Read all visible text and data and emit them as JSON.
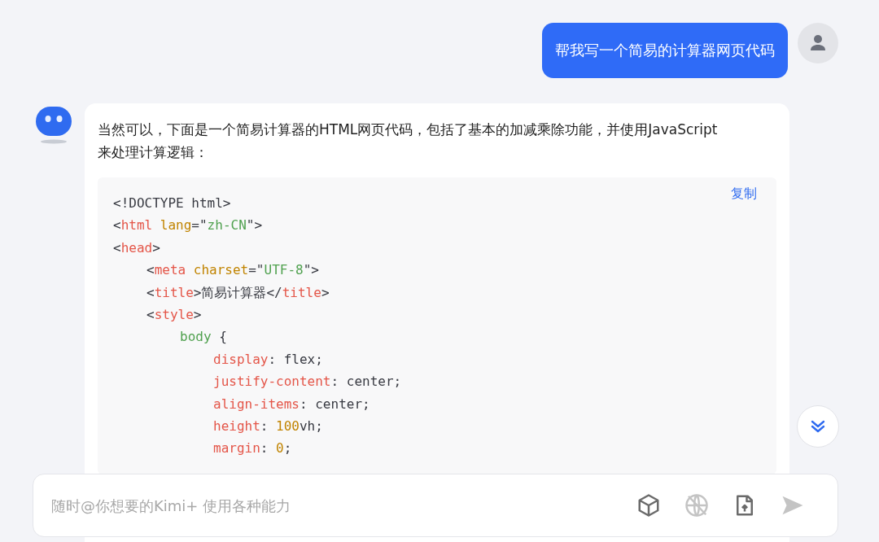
{
  "user_message": {
    "text": "帮我写一个简易的计算器网页代码"
  },
  "assistant_message": {
    "text": "当然可以，下面是一个简易计算器的HTML网页代码，包括了基本的加减乘除功能，并使用JavaScript来处理计算逻辑：",
    "code_block": {
      "copy_label": "复制",
      "lines": [
        {
          "tokens": [
            {
              "kind": "plain",
              "text": "<!DOCTYPE html>"
            }
          ]
        },
        {
          "tokens": [
            {
              "kind": "plain",
              "text": "<"
            },
            {
              "kind": "tag",
              "text": "html"
            },
            {
              "kind": "attr",
              "text": " lang"
            },
            {
              "kind": "plain",
              "text": "=\""
            },
            {
              "kind": "string",
              "text": "zh-CN"
            },
            {
              "kind": "plain",
              "text": "\">"
            }
          ]
        },
        {
          "tokens": [
            {
              "kind": "plain",
              "text": "<"
            },
            {
              "kind": "tag",
              "text": "head"
            },
            {
              "kind": "plain",
              "text": ">"
            }
          ],
          "children": [
            {
              "tokens": [
                {
                  "kind": "plain",
                  "text": "<"
                },
                {
                  "kind": "tag",
                  "text": "meta"
                },
                {
                  "kind": "attr",
                  "text": " charset"
                },
                {
                  "kind": "plain",
                  "text": "=\""
                },
                {
                  "kind": "string",
                  "text": "UTF-8"
                },
                {
                  "kind": "plain",
                  "text": "\">"
                }
              ]
            },
            {
              "tokens": [
                {
                  "kind": "plain",
                  "text": "<"
                },
                {
                  "kind": "tag",
                  "text": "title"
                },
                {
                  "kind": "plain",
                  "text": ">简易计算器</"
                },
                {
                  "kind": "tag",
                  "text": "title"
                },
                {
                  "kind": "plain",
                  "text": ">"
                }
              ]
            },
            {
              "tokens": [
                {
                  "kind": "plain",
                  "text": "<"
                },
                {
                  "kind": "tag",
                  "text": "style"
                },
                {
                  "kind": "plain",
                  "text": ">"
                }
              ],
              "children": [
                {
                  "tokens": [
                    {
                      "kind": "selector",
                      "text": "body"
                    },
                    {
                      "kind": "plain",
                      "text": " {"
                    }
                  ],
                  "children": [
                    {
                      "tokens": [
                        {
                          "kind": "tag",
                          "text": "display"
                        },
                        {
                          "kind": "plain",
                          "text": ": flex;"
                        }
                      ]
                    },
                    {
                      "tokens": [
                        {
                          "kind": "tag",
                          "text": "justify-content"
                        },
                        {
                          "kind": "plain",
                          "text": ": center;"
                        }
                      ]
                    },
                    {
                      "tokens": [
                        {
                          "kind": "tag",
                          "text": "align-items"
                        },
                        {
                          "kind": "plain",
                          "text": ": center;"
                        }
                      ]
                    },
                    {
                      "tokens": [
                        {
                          "kind": "tag",
                          "text": "height"
                        },
                        {
                          "kind": "plain",
                          "text": ": "
                        },
                        {
                          "kind": "attr",
                          "text": "100"
                        },
                        {
                          "kind": "plain",
                          "text": "vh;"
                        }
                      ]
                    },
                    {
                      "tokens": [
                        {
                          "kind": "tag",
                          "text": "margin"
                        },
                        {
                          "kind": "plain",
                          "text": ": "
                        },
                        {
                          "kind": "attr",
                          "text": "0"
                        },
                        {
                          "kind": "plain",
                          "text": ";"
                        }
                      ]
                    }
                  ]
                }
              ]
            }
          ]
        }
      ]
    }
  },
  "composer": {
    "placeholder": "随时@你想要的Kimi+ 使用各种能力",
    "web_search_disabled": true
  }
}
